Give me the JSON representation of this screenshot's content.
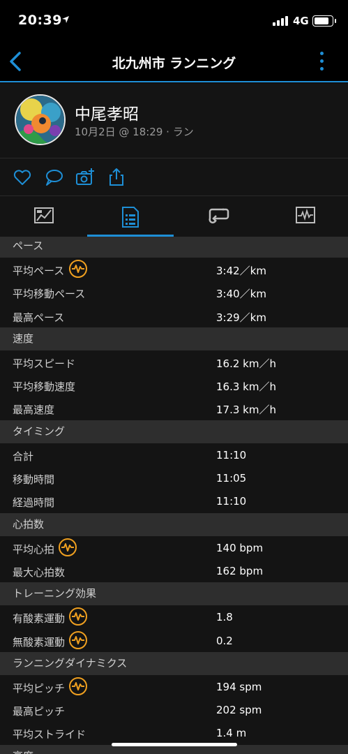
{
  "status_bar": {
    "time": "20:39",
    "network": "4G",
    "battery_level": 0.85
  },
  "nav": {
    "title": "北九州市 ランニング"
  },
  "profile": {
    "name": "中尾孝昭",
    "meta": "10月2日 @ 18:29 · ラン"
  },
  "actions": [
    {
      "icon": "heart-icon"
    },
    {
      "icon": "comment-icon"
    },
    {
      "icon": "add-photo-icon"
    },
    {
      "icon": "share-icon"
    }
  ],
  "tabs": [
    {
      "icon": "map-icon",
      "active": false
    },
    {
      "icon": "stats-icon",
      "active": true
    },
    {
      "icon": "laps-icon",
      "active": false
    },
    {
      "icon": "chart-icon",
      "active": false
    }
  ],
  "colors": {
    "accent": "#1e8fd6",
    "hr_icon": "#f0a020",
    "section_bg": "#2e2e2e",
    "row_bg": "#141414"
  },
  "sections": [
    {
      "title": "ペース",
      "rows": [
        {
          "label": "平均ペース",
          "value": "3:42／km",
          "hr_icon": true
        },
        {
          "label": "平均移動ペース",
          "value": "3:40／km",
          "hr_icon": false
        },
        {
          "label": "最高ペース",
          "value": "3:29／km",
          "hr_icon": false
        }
      ]
    },
    {
      "title": "速度",
      "rows": [
        {
          "label": "平均スピード",
          "value": "16.2 km／h",
          "hr_icon": false
        },
        {
          "label": "平均移動速度",
          "value": "16.3 km／h",
          "hr_icon": false
        },
        {
          "label": "最高速度",
          "value": "17.3 km／h",
          "hr_icon": false
        }
      ]
    },
    {
      "title": "タイミング",
      "rows": [
        {
          "label": "合計",
          "value": "11:10",
          "hr_icon": false
        },
        {
          "label": "移動時間",
          "value": "11:05",
          "hr_icon": false
        },
        {
          "label": "経過時間",
          "value": "11:10",
          "hr_icon": false
        }
      ]
    },
    {
      "title": "心拍数",
      "rows": [
        {
          "label": "平均心拍",
          "value": "140 bpm",
          "hr_icon": true
        },
        {
          "label": "最大心拍数",
          "value": "162 bpm",
          "hr_icon": false
        }
      ]
    },
    {
      "title": "トレーニング効果",
      "rows": [
        {
          "label": "有酸素運動",
          "value": "1.8",
          "hr_icon": true
        },
        {
          "label": "無酸素運動",
          "value": "0.2",
          "hr_icon": true
        }
      ]
    },
    {
      "title": "ランニングダイナミクス",
      "rows": [
        {
          "label": "平均ピッチ",
          "value": "194 spm",
          "hr_icon": true
        },
        {
          "label": "最高ピッチ",
          "value": "202 spm",
          "hr_icon": false
        },
        {
          "label": "平均ストライド",
          "value": "1.4 m",
          "hr_icon": false
        }
      ]
    },
    {
      "title": "高度",
      "rows": []
    }
  ]
}
